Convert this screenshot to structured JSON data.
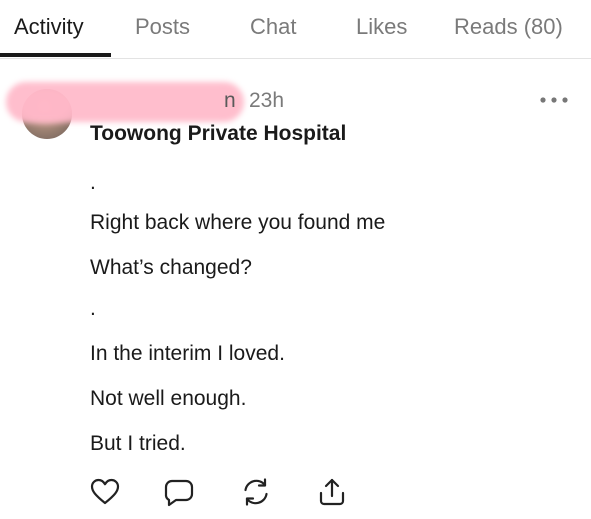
{
  "tabs": [
    {
      "label": "Activity"
    },
    {
      "label": "Posts"
    },
    {
      "label": "Chat"
    },
    {
      "label": "Likes"
    },
    {
      "label": "Reads (80)"
    }
  ],
  "active_tab": "Activity",
  "post": {
    "author_tail": "n",
    "timestamp": "23h",
    "title": "Toowong Private Hospital",
    "lines": [
      ".",
      "Right back where you found me",
      "What’s changed?",
      ".",
      "In the interim I loved.",
      "Not well enough.",
      "But I tried."
    ]
  },
  "icons": {
    "more": "more-horizontal-icon",
    "like": "heart-icon",
    "comment": "comment-bubble-icon",
    "restack": "restack-icon",
    "share": "share-icon"
  },
  "colors": {
    "text": "#1a1a1a",
    "muted": "#7a7a7a",
    "redaction": "#ffb7c8"
  }
}
